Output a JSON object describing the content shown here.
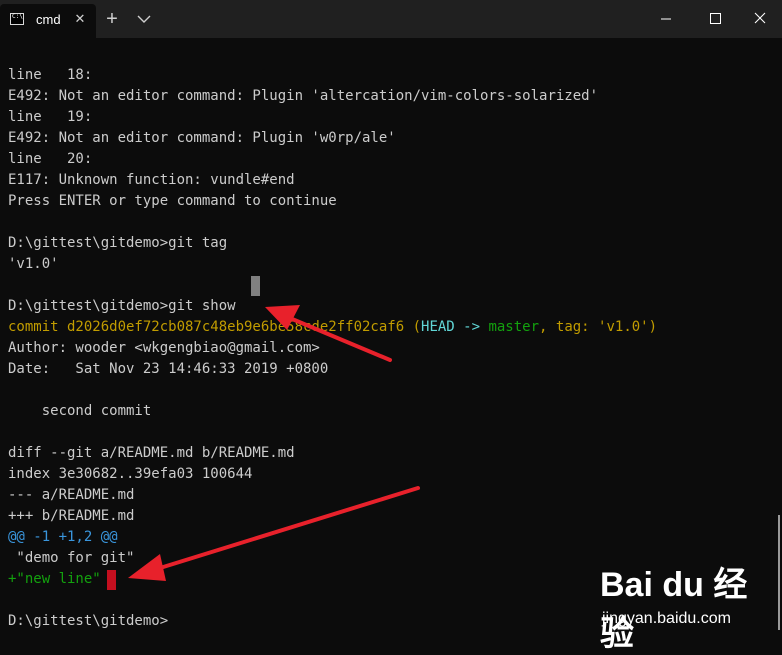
{
  "titlebar": {
    "tab_title": "cmd",
    "tab_icon": "cmd-prompt-icon",
    "close_tab_glyph": "✕",
    "new_tab_glyph": "+",
    "colors": {
      "background": "#202020",
      "tab": "#0c0c0c",
      "text": "#ffffff"
    }
  },
  "terminal": {
    "colors": {
      "background": "#0c0c0c",
      "text": "#cccccc",
      "commit_yellow": "#c19c00",
      "diff_cyan": "#3a96dd",
      "diff_green": "#13a10e",
      "head_cyan": "#61d6d6"
    },
    "lines": {
      "l1": "line   18:",
      "l2": "E492: Not an editor command: Plugin 'altercation/vim-colors-solarized'",
      "l3": "line   19:",
      "l4": "E492: Not an editor command: Plugin 'w0rp/ale'",
      "l5": "line   20:",
      "l6": "E117: Unknown function: vundle#end",
      "l7": "Press ENTER or type command to continue",
      "l9": "D:\\gittest\\gitdemo>git tag",
      "l10": "'v1.0'",
      "l12": "D:\\gittest\\gitdemo>git show",
      "commit_prefix": "commit d2026d0ef72cb087c48eb9e6be58cde2ff02caf6 ",
      "commit_paren_open": "(",
      "commit_head": "HEAD -> ",
      "commit_master": "master",
      "commit_tag_sep": ", ",
      "commit_tag": "tag: 'v1.0'",
      "commit_paren_close": ")",
      "l14": "Author: wooder <wkgengbiao@gmail.com>",
      "l15": "Date:   Sat Nov 23 14:46:33 2019 +0800",
      "l17": "    second commit",
      "l19": "diff --git a/README.md b/README.md",
      "l20": "index 3e30682..39efa03 100644",
      "l21": "--- a/README.md",
      "l22": "+++ b/README.md",
      "l23": "@@ -1 +1,2 @@",
      "l24": " \"demo for git\"",
      "l25": "+\"new line\"",
      "l27": "D:\\gittest\\gitdemo>"
    }
  },
  "watermark": {
    "logo": "Bai du 经验",
    "url": "jingyan.baidu.com"
  }
}
